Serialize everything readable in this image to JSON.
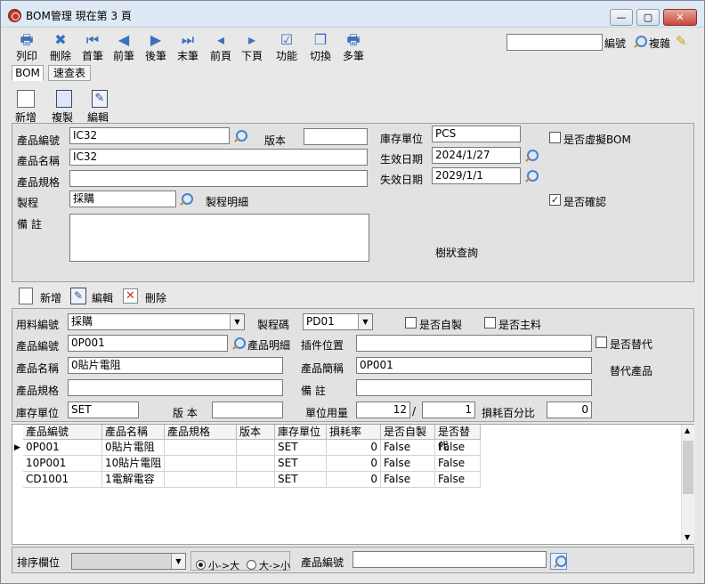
{
  "window": {
    "title": "BOM管理  現在第 3 頁"
  },
  "toolbar": {
    "items": [
      {
        "label": "列印",
        "icon": "printer-icon",
        "glyph": "🖶"
      },
      {
        "label": "刪除",
        "icon": "delete-icon",
        "glyph": "✖"
      },
      {
        "label": "首筆",
        "icon": "first-record-icon",
        "glyph": "⏮"
      },
      {
        "label": "前筆",
        "icon": "previous-record-icon",
        "glyph": "◀"
      },
      {
        "label": "後筆",
        "icon": "next-record-icon",
        "glyph": "▶"
      },
      {
        "label": "末筆",
        "icon": "last-record-icon",
        "glyph": "⏭"
      },
      {
        "label": "前頁",
        "icon": "previous-page-icon",
        "glyph": "◂"
      },
      {
        "label": "下頁",
        "icon": "next-page-icon",
        "glyph": "▸"
      },
      {
        "label": "功能",
        "icon": "function-icon",
        "glyph": "☑"
      },
      {
        "label": "切換",
        "icon": "switch-icon",
        "glyph": "❐"
      },
      {
        "label": "多筆",
        "icon": "multi-record-icon",
        "glyph": "🖶"
      }
    ],
    "search_value": "",
    "search_label": "編號",
    "complex_label": "複雜"
  },
  "tabs": [
    {
      "label": "BOM"
    },
    {
      "label": "速查表"
    }
  ],
  "bom_actions": {
    "new": "新增",
    "copy": "複製",
    "edit": "編輯"
  },
  "header": {
    "product_code_label": "產品編號",
    "product_code": "IC32",
    "version_label": "版本",
    "version": "",
    "stock_unit_label": "庫存單位",
    "stock_unit": "PCS",
    "virtual_bom_label": "是否虛擬BOM",
    "product_name_label": "產品名稱",
    "product_name": "IC32",
    "effective_date_label": "生效日期",
    "effective_date": "2024/1/27",
    "product_spec_label": "產品規格",
    "product_spec": "",
    "expiry_date_label": "失效日期",
    "expiry_date": "2029/1/1",
    "process_label": "製程",
    "process": "採購",
    "process_detail_label": "製程明細",
    "confirmed_label": "是否確認",
    "remark_label": "備    註",
    "remark": "",
    "tree_query_label": "樹狀查詢"
  },
  "detail_actions": {
    "new": "新增",
    "edit": "編輯",
    "delete": "刪除"
  },
  "detail": {
    "material_code_label": "用料編號",
    "material_code": "採購",
    "process_code_label": "製程碼",
    "process_code": "PD01",
    "self_made_label": "是否自製",
    "main_material_label": "是否主料",
    "product_code_label": "產品編號",
    "product_code": "0P001",
    "product_detail_label": "產品明細",
    "insert_position_label": "插件位置",
    "insert_position": "",
    "substitute_label": "是否替代",
    "product_name_label": "產品名稱",
    "product_name": "0貼片電阻",
    "product_short_label": "產品簡稱",
    "product_short": "0P001",
    "substitute_product_label": "替代產品",
    "product_spec_label": "產品規格",
    "product_spec": "",
    "remark_label": "備    註",
    "remark": "",
    "stock_unit_label": "庫存單位",
    "stock_unit": "SET",
    "version_label": "版  本",
    "version": "",
    "unit_usage_label": "單位用量",
    "unit_usage": "12",
    "unit_usage_divisor": "1",
    "loss_percent_label": "損耗百分比",
    "loss_percent": "0"
  },
  "grid": {
    "columns": [
      "產品編號",
      "產品名稱",
      "產品規格",
      "版本",
      "庫存單位",
      "損耗率",
      "是否自製",
      "是否替代"
    ],
    "rows": [
      [
        "0P001",
        "0貼片電阻",
        "",
        "",
        "SET",
        "0",
        "False",
        "False"
      ],
      [
        "10P001",
        "10貼片電阻",
        "",
        "",
        "SET",
        "0",
        "False",
        "False"
      ],
      [
        "CD1001",
        "1電解電容",
        "",
        "",
        "SET",
        "0",
        "False",
        "False"
      ]
    ]
  },
  "footer": {
    "sort_label": "排序欄位",
    "sort_value": "",
    "asc_label": "小->大",
    "desc_label": "大->小",
    "product_code_label": "產品編號",
    "product_code": ""
  },
  "colors": {
    "titlebar": "#dfe9f5",
    "panel": "#e2e2e2",
    "accent": "#3b6fc0"
  }
}
